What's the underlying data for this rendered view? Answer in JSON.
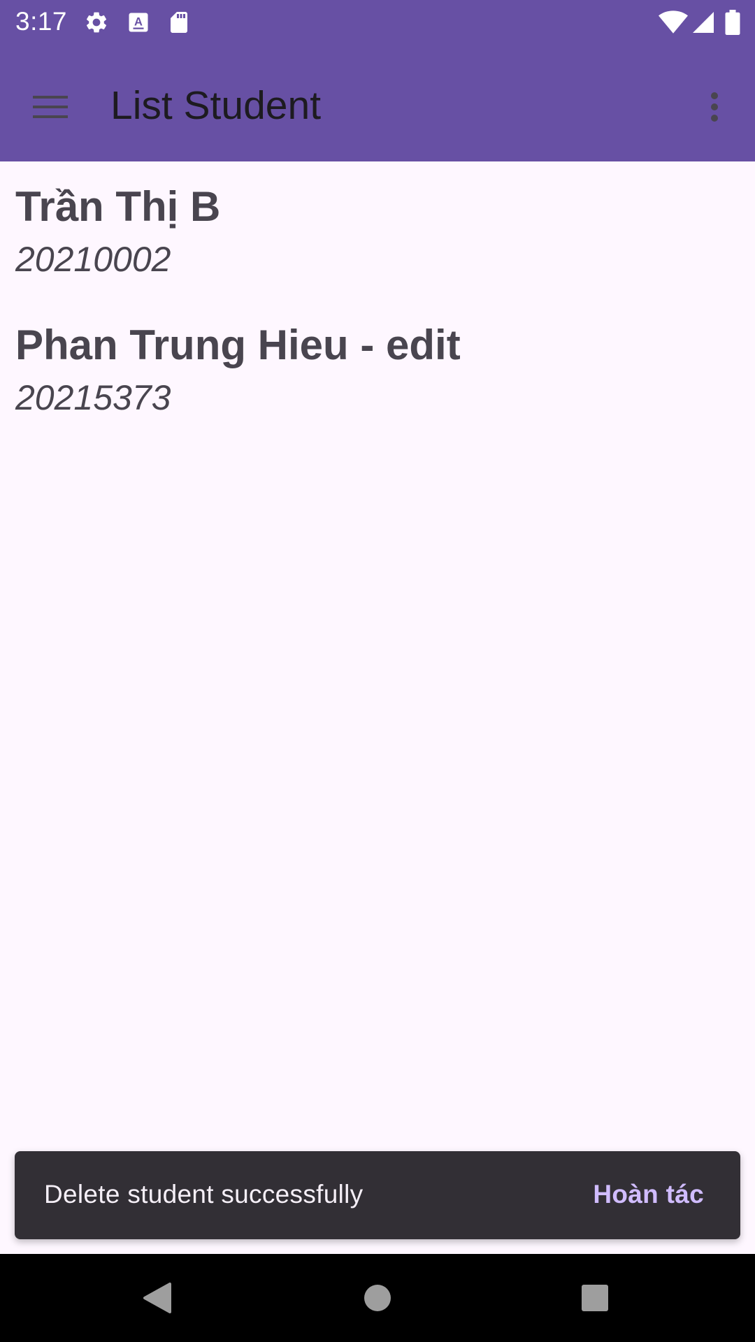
{
  "status_bar": {
    "time": "3:17",
    "left_icons": [
      "gear-icon",
      "keyboard-a-icon",
      "sd-card-icon"
    ],
    "right_icons": [
      "wifi-icon",
      "cell-signal-icon",
      "battery-icon"
    ]
  },
  "app_bar": {
    "title": "List Student",
    "menu_icon": "hamburger-menu-icon",
    "overflow_icon": "more-vert-icon",
    "background": "#6750A4"
  },
  "students": [
    {
      "name": "Trần Thị B",
      "id": "20210002"
    },
    {
      "name": "Phan Trung Hieu - edit",
      "id": "20215373"
    }
  ],
  "snackbar": {
    "message": "Delete student successfully",
    "action": "Hoàn tác",
    "background": "#322F35",
    "action_color": "#D0BCFF"
  },
  "nav_bar": {
    "buttons": [
      "back-icon",
      "home-icon",
      "recents-icon"
    ]
  }
}
